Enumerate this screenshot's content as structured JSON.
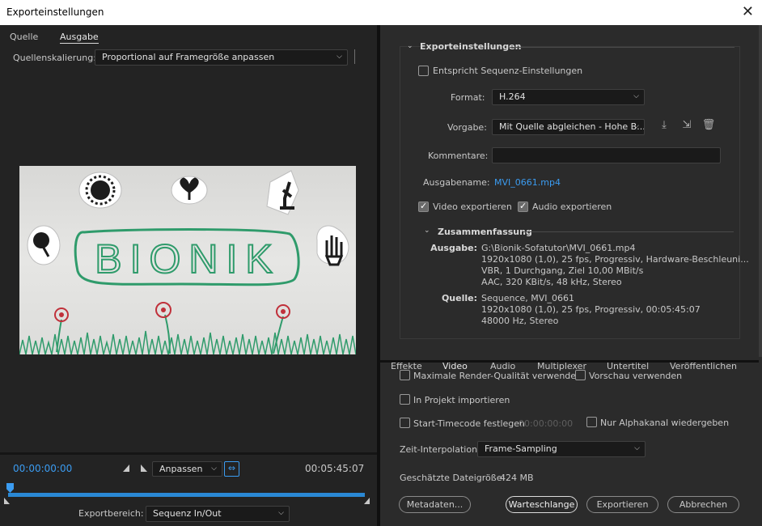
{
  "window": {
    "title": "Exporteinstellungen"
  },
  "source_tabs": [
    {
      "label": "Quelle"
    },
    {
      "label": "Ausgabe"
    }
  ],
  "source_scaling": {
    "label": "Quellenskalierung:",
    "value": "Proportional auf Framegröße anpassen"
  },
  "preview": {
    "board_text": "BIONIK"
  },
  "timeline": {
    "current_time": "00:00:00:00",
    "duration": "00:05:45:07",
    "fit": "Anpassen",
    "progress": 0.0,
    "export_range_label": "Exportbereich:",
    "export_range_value": "Sequenz In/Out"
  },
  "export_settings": {
    "heading": "Exporteinstellungen",
    "match_sequence": "Entspricht Sequenz-Einstellungen",
    "format_label": "Format:",
    "format_value": "H.264",
    "preset_label": "Vorgabe:",
    "preset_value": "Mit Quelle abgleichen - Hohe B...",
    "comments_label": "Kommentare:",
    "comments_value": "",
    "output_name_label": "Ausgabename:",
    "output_name_value": "MVI_0661.mp4",
    "export_video": "Video exportieren",
    "export_audio": "Audio exportieren"
  },
  "summary": {
    "heading": "Zusammenfassung",
    "output_label": "Ausgabe:",
    "output_lines": [
      "G:\\Bionik-Sofatutor\\MVI_0661.mp4",
      "1920x1080 (1,0), 25 fps, Progressiv, Hardware-Beschleuni...",
      "VBR, 1 Durchgang, Ziel 10,00 MBit/s",
      "AAC, 320 KBit/s, 48 kHz, Stereo"
    ],
    "source_label": "Quelle:",
    "source_lines": [
      "Sequence, MVI_0661",
      "1920x1080 (1,0), 25 fps, Progressiv, 00:05:45:07",
      "48000 Hz, Stereo"
    ]
  },
  "bottom_tabs": [
    {
      "label": "Effekte"
    },
    {
      "label": "Video"
    },
    {
      "label": "Audio"
    },
    {
      "label": "Multiplexer"
    },
    {
      "label": "Untertitel"
    },
    {
      "label": "Veröffentlichen"
    }
  ],
  "options": {
    "max_render_quality": "Maximale Render-Qualität verwenden",
    "use_previews": "Vorschau verwenden",
    "import_into_project": "In Projekt importieren",
    "set_start_timecode": "Start-Timecode festlegen",
    "start_timecode_value": "00:00:00:00",
    "render_alpha_only": "Nur Alphakanal wiedergeben",
    "time_interpolation_label": "Zeit-Interpolation:",
    "time_interpolation_value": "Frame-Sampling",
    "estimated_size_label": "Geschätzte Dateigröße:",
    "estimated_size_value": "424 MB"
  },
  "buttons": {
    "metadata": "Metadaten...",
    "queue": "Warteschlange",
    "export": "Exportieren",
    "cancel": "Abbrechen"
  },
  "colors": {
    "accent": "#3b9cf1",
    "panel": "#2b2b2b",
    "marker_green": "#2f9b6b",
    "flower_red": "#c0303a"
  }
}
